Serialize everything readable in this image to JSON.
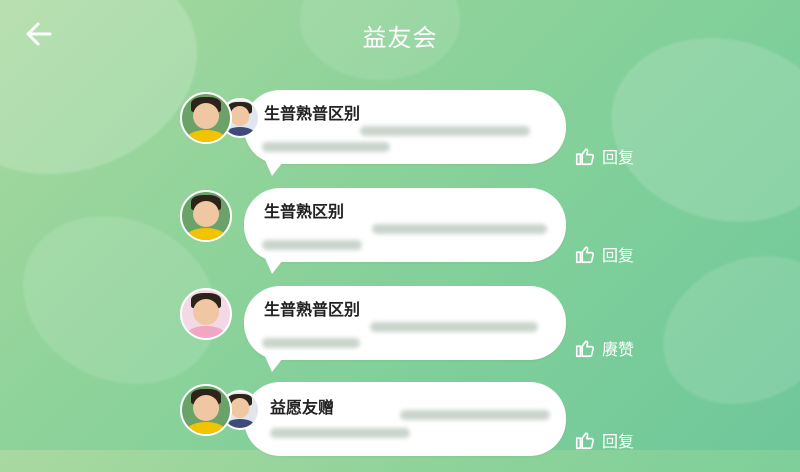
{
  "header": {
    "title": "益友会"
  },
  "messages": [
    {
      "sender": "生普熟普区别",
      "action_label": "回复"
    },
    {
      "sender": "生普熟区别",
      "action_label": "回复"
    },
    {
      "sender": "生普熟普区别",
      "action_label": "赓赞"
    },
    {
      "sender": "益愿友赠",
      "action_label": "回复"
    }
  ],
  "icons": {
    "back": "back-arrow-icon",
    "like": "thumbs-up-icon"
  },
  "colors": {
    "bg_start": "#a9d9a0",
    "bg_end": "#6fc79a",
    "bubble": "#ffffff",
    "text_dark": "#222222"
  }
}
